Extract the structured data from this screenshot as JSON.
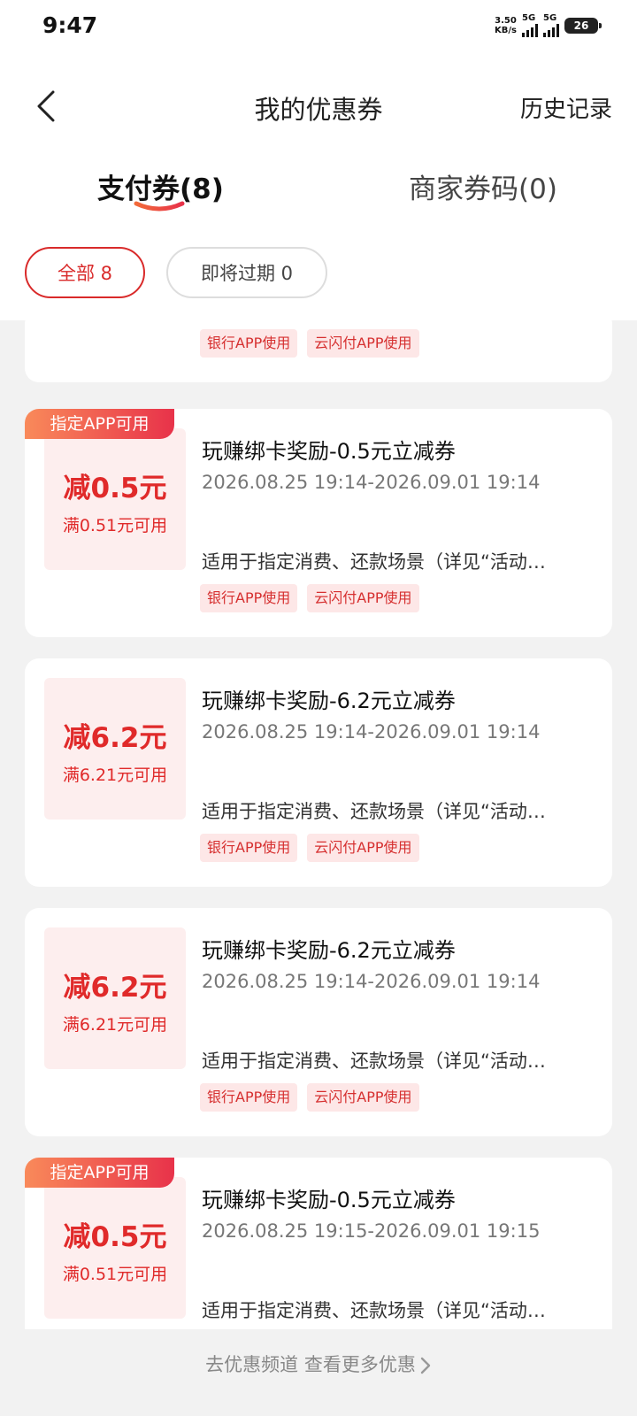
{
  "status": {
    "time": "9:47",
    "speed_top": "3.50",
    "speed_bottom": "KB/s",
    "sig1": "5G",
    "sig2": "5G",
    "battery": "26"
  },
  "header": {
    "title": "我的优惠券",
    "history": "历史记录"
  },
  "tabs": [
    {
      "label": "支付券(8)"
    },
    {
      "label": "商家券码(0)"
    }
  ],
  "filters": [
    {
      "label": "全部 8"
    },
    {
      "label": "即将过期 0"
    }
  ],
  "colors": {
    "accent": "#e02a2a",
    "badge_start": "#f98a5a",
    "badge_end": "#e8324a"
  },
  "coupons": [
    {
      "tags": [
        "银行APP使用",
        "云闪付APP使用"
      ]
    },
    {
      "badge": "指定APP可用",
      "amount": "减0.5元",
      "condition": "满0.51元可用",
      "title": "玩赚绑卡奖励-0.5元立减券",
      "period": "2026.08.25 19:14-2026.09.01 19:14",
      "desc": "适用于指定消费、还款场景（详见“活动…",
      "tags": [
        "银行APP使用",
        "云闪付APP使用"
      ]
    },
    {
      "amount": "减6.2元",
      "condition": "满6.21元可用",
      "title": "玩赚绑卡奖励-6.2元立减券",
      "period": "2026.08.25 19:14-2026.09.01 19:14",
      "desc": "适用于指定消费、还款场景（详见“活动…",
      "tags": [
        "银行APP使用",
        "云闪付APP使用"
      ]
    },
    {
      "amount": "减6.2元",
      "condition": "满6.21元可用",
      "title": "玩赚绑卡奖励-6.2元立减券",
      "period": "2026.08.25 19:14-2026.09.01 19:14",
      "desc": "适用于指定消费、还款场景（详见“活动…",
      "tags": [
        "银行APP使用",
        "云闪付APP使用"
      ]
    },
    {
      "badge": "指定APP可用",
      "amount": "减0.5元",
      "condition": "满0.51元可用",
      "title": "玩赚绑卡奖励-0.5元立减券",
      "period": "2026.08.25 19:15-2026.09.01 19:15",
      "desc": "适用于指定消费、还款场景（详见“活动…"
    }
  ],
  "footer": {
    "link": "去优惠频道 查看更多优惠"
  }
}
